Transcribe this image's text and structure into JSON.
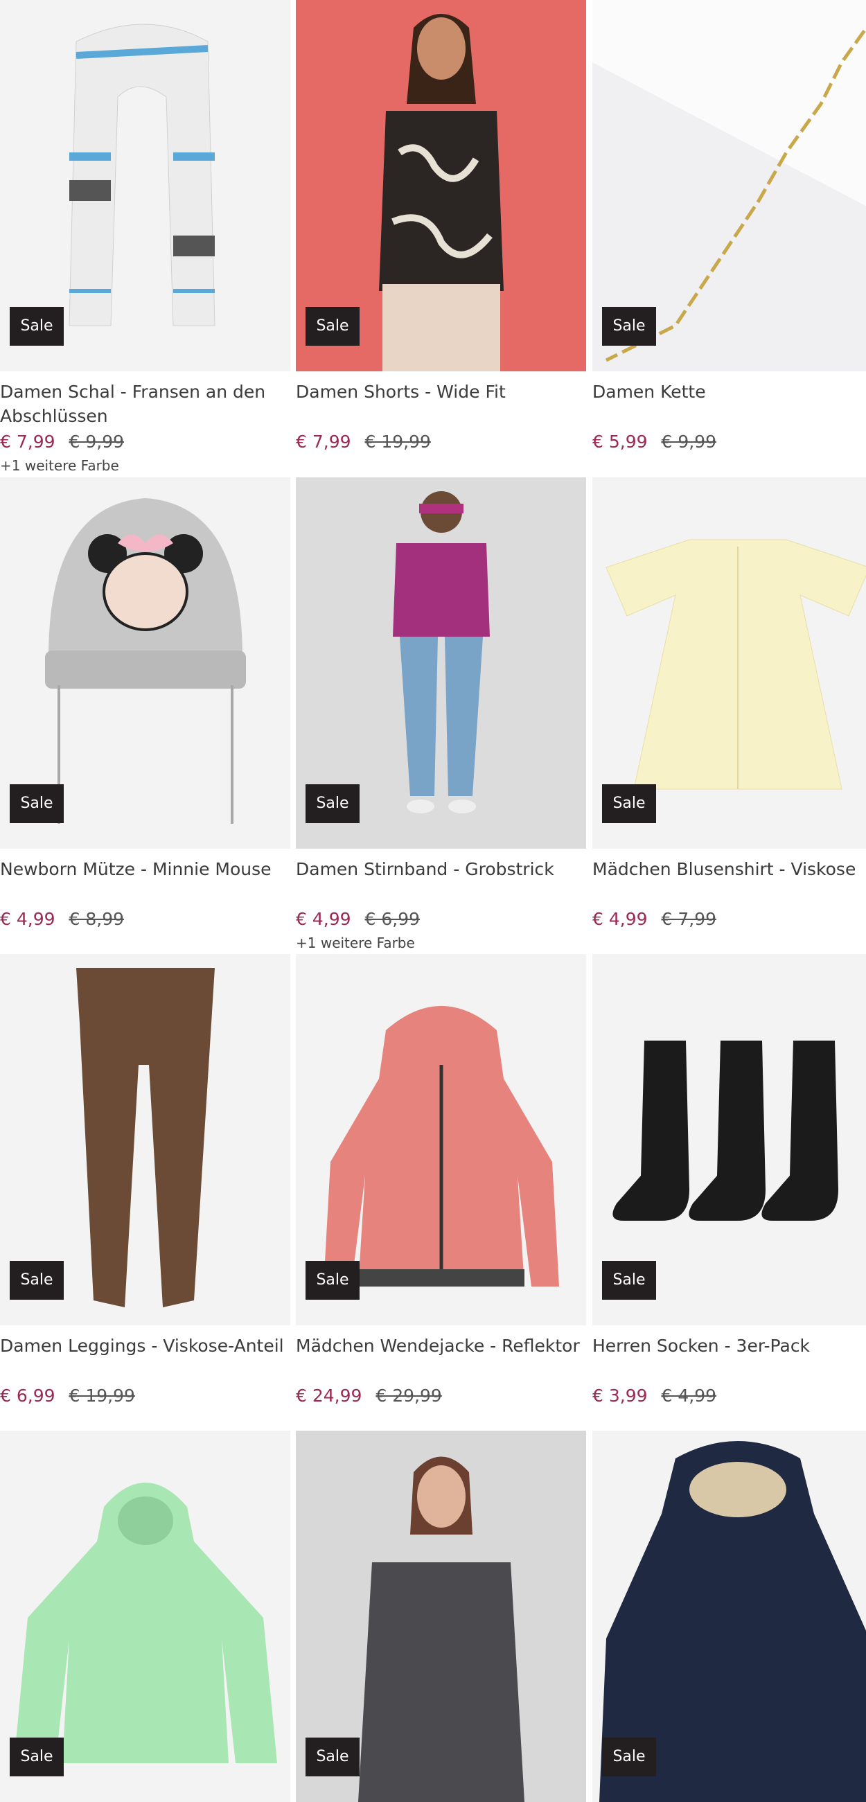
{
  "sale_label": "Sale",
  "colors": {
    "price": "#9c2954",
    "badge_bg": "#231f20",
    "image_bg": "#f3f3f3"
  },
  "products": [
    {
      "title": "Damen Schal - Fransen an den Abschlüssen",
      "price": "€ 7,99",
      "old_price": "€ 9,99",
      "more": "+1 weitere Farbe",
      "image": "scarf"
    },
    {
      "title": "Damen Shorts - Wide Fit",
      "price": "€ 7,99",
      "old_price": "€ 19,99",
      "more": "",
      "image": "model-top"
    },
    {
      "title": "Damen Kette",
      "price": "€ 5,99",
      "old_price": "€ 9,99",
      "more": "",
      "image": "chain"
    },
    {
      "title": "Newborn Mütze - Minnie Mouse",
      "price": "€ 4,99",
      "old_price": "€ 8,99",
      "more": "",
      "image": "beanie"
    },
    {
      "title": "Damen Stirnband - Grobstrick",
      "price": "€ 4,99",
      "old_price": "€ 6,99",
      "more": "+1 weitere Farbe",
      "image": "headband-model"
    },
    {
      "title": "Mädchen Blusenshirt - Viskose",
      "price": "€ 4,99",
      "old_price": "€ 7,99",
      "more": "",
      "image": "blouse"
    },
    {
      "title": "Damen Leggings - Viskose-Anteil",
      "price": "€ 6,99",
      "old_price": "€ 19,99",
      "more": "",
      "image": "leggings"
    },
    {
      "title": "Mädchen Wendejacke - Reflektor",
      "price": "€ 24,99",
      "old_price": "€ 29,99",
      "more": "",
      "image": "puffer-jacket"
    },
    {
      "title": "Herren Socken - 3er-Pack",
      "price": "€ 3,99",
      "old_price": "€ 4,99",
      "more": "",
      "image": "socks"
    },
    {
      "title": "",
      "price": "",
      "old_price": "",
      "more": "",
      "image": "hoodie"
    },
    {
      "title": "",
      "price": "",
      "old_price": "",
      "more": "",
      "image": "sweater-model"
    },
    {
      "title": "",
      "price": "",
      "old_price": "",
      "more": "",
      "image": "parka"
    }
  ]
}
